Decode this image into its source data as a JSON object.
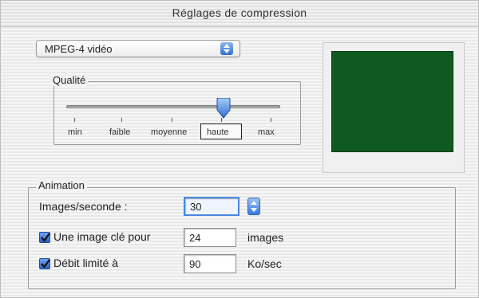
{
  "window": {
    "title": "Réglages de compression"
  },
  "codec": {
    "selected": "MPEG-4 vidéo"
  },
  "quality": {
    "group_label": "Qualité",
    "level": 0.75,
    "ticks": [
      "min",
      "faible",
      "moyenne",
      "haute",
      "max"
    ],
    "selected_tick": "haute"
  },
  "animation": {
    "group_label": "Animation",
    "fps_label": "Images/seconde :",
    "fps_value": "30",
    "keyframe": {
      "checked": true,
      "label": "Une image clé pour",
      "value": "24",
      "unit": "images"
    },
    "datarate": {
      "checked": true,
      "label": "Débit limité à",
      "value": "90",
      "unit": "Ko/sec"
    }
  },
  "preview": {
    "color": "#0f5a22"
  },
  "colors": {
    "accent": "#3b7ad8"
  }
}
